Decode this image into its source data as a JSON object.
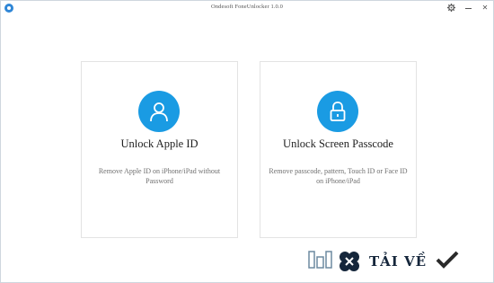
{
  "window": {
    "title": "Ondesoft FoneUnlocker 1.0.0",
    "settings_icon": "gear-icon",
    "minimize_icon": "minimize-icon",
    "close_label": "✕"
  },
  "cards": [
    {
      "title": "Unlock Apple ID",
      "description": "Remove Apple ID on iPhone/iPad without Password",
      "icon": "user-icon"
    },
    {
      "title": "Unlock Screen Passcode",
      "description": "Remove passcode, pattern, Touch ID or Face ID on iPhone/iPad",
      "icon": "lock-icon"
    }
  ],
  "watermark": {
    "text": "TẢI VỀ",
    "icon": "check-icon"
  },
  "colors": {
    "accent": "#1a9be3",
    "card_border": "#e3e3e3",
    "title_text": "#1f1f1f",
    "desc_text": "#6f6f6f"
  }
}
